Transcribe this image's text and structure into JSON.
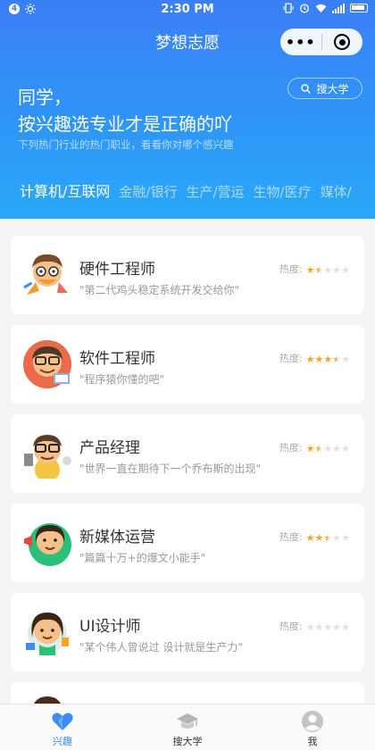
{
  "status_bar": {
    "time": "2:30 PM",
    "notification_badge": "4"
  },
  "nav": {
    "title": "梦想志愿"
  },
  "search": {
    "label": "搜大学"
  },
  "hero": {
    "greeting_line1": "同学，",
    "greeting_line2": "按兴趣选专业才是正确的吖",
    "subtitle": "下列热门行业的热门职业，看看你对哪个感兴趣"
  },
  "categories": [
    {
      "label": "计算机/互联网",
      "active": true
    },
    {
      "label": "金融/银行",
      "active": false
    },
    {
      "label": "生产/营运",
      "active": false
    },
    {
      "label": "生物/医疗",
      "active": false
    },
    {
      "label": "媒体/",
      "active": false
    }
  ],
  "heat_label": "热度:",
  "jobs": [
    {
      "title": "硬件工程师",
      "desc": "\"第二代鸡头稳定系统开发交给你\"",
      "rating": 1.5
    },
    {
      "title": "软件工程师",
      "desc": "\"程序猿你懂的吧\"",
      "rating": 3.5
    },
    {
      "title": "产品经理",
      "desc": "\"世界一直在期待下一个乔布斯的出现\"",
      "rating": 1.5
    },
    {
      "title": "新媒体运营",
      "desc": "\"篇篇十万+的爆文小能手\"",
      "rating": 2.5
    },
    {
      "title": "UI设计师",
      "desc": "\"某个伟人曾说过 设计就是生产力\"",
      "rating": 0
    }
  ],
  "tabs": [
    {
      "label": "兴趣",
      "icon": "heart-icon",
      "active": true
    },
    {
      "label": "搜大学",
      "icon": "graduation-cap-icon",
      "active": false
    },
    {
      "label": "我",
      "icon": "profile-icon",
      "active": false
    }
  ],
  "colors": {
    "primary": "#3b7ff5",
    "star": "#f5a623",
    "active_tab": "#3b8cf5"
  }
}
